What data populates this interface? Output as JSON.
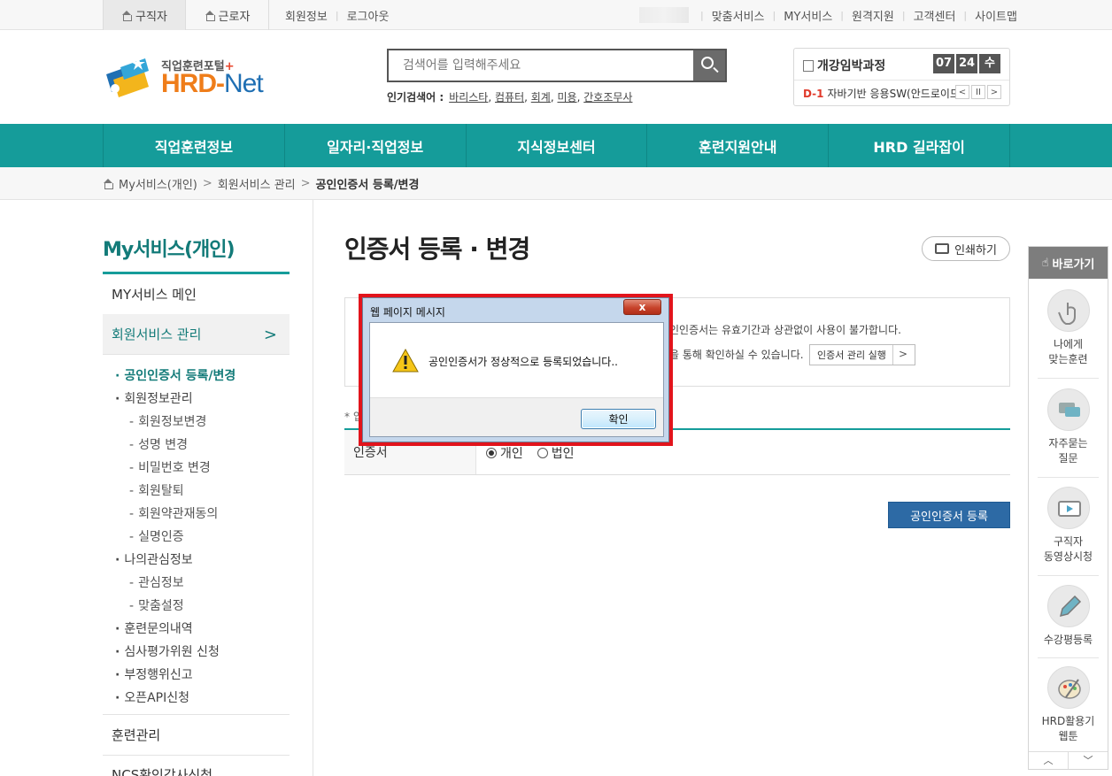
{
  "topbar": {
    "tab_job_seeker": "구직자",
    "tab_worker": "근로자",
    "member_info": "회원정보",
    "logout": "로그아웃",
    "links": [
      "맞춤서비스",
      "MY서비스",
      "원격지원",
      "고객센터",
      "사이트맵"
    ]
  },
  "header": {
    "logo_sub": "직업훈련포털",
    "logo_plus": "+",
    "logo_main_a": "HRD",
    "logo_main_dash": "-",
    "logo_main_b": "Net",
    "search_placeholder": "검색어를 입력해주세요",
    "popular_label": "인기검색어 :",
    "popular_terms": [
      "바리스타",
      "컴퓨터",
      "회계",
      "미용",
      "간호조무사"
    ],
    "opening_title": "개강임박과정",
    "date_month": "07",
    "date_day": "24",
    "date_weekday": "수",
    "dday": "D-1",
    "course_name": "자바기반 응용SW(안드로이드",
    "ctrl_prev": "<",
    "ctrl_pause": "II",
    "ctrl_next": ">"
  },
  "gnb": [
    "직업훈련정보",
    "일자리·직업정보",
    "지식정보센터",
    "훈련지원안내",
    "HRD 길라잡이"
  ],
  "breadcrumb": {
    "items": [
      "My서비스(개인)",
      "회원서비스 관리",
      "공인인증서 등록/변경"
    ]
  },
  "lnb": {
    "title": "My서비스(개인)",
    "main_1": "MY서비스 메인",
    "main_2": "회원서비스 관리",
    "main_2_chev": ">",
    "sub": [
      "공인인증서 등록/변경",
      "회원정보관리",
      "회원정보변경",
      "성명 변경",
      "비밀번호 변경",
      "회원탈퇴",
      "회원약관재동의",
      "실명인증",
      "나의관심정보",
      "관심정보",
      "맞춤설정",
      "훈련문의내역",
      "심사평가위원 신청",
      "부정행위신고",
      "오픈API신청"
    ],
    "main_3": "훈련관리",
    "main_4": "NCS확인강사신청"
  },
  "content": {
    "title": "인증서 등록 · 변경",
    "print_label": "인쇄하기",
    "info_line1": "인인증서는 유효기간과 상관없이 사용이 불가합니다.",
    "info_line2": "을 통해 확인하실 수 있습니다.",
    "manager_btn": "인증서 관리 실행",
    "manager_gt": ">",
    "required_note": "* 입",
    "field_label": "인증서",
    "radio_personal": "개인",
    "radio_corporate": "법인",
    "register_btn": "공인인증서 등록"
  },
  "quick": {
    "title": "바로가기",
    "items": [
      {
        "line1": "나에게",
        "line2": "맞는훈련"
      },
      {
        "line1": "자주묻는",
        "line2": "질문"
      },
      {
        "line1": "구직자",
        "line2": "동영상시청"
      },
      {
        "line1": "수강평등록",
        "line2": ""
      },
      {
        "line1": "HRD활용기",
        "line2": "웹툰"
      }
    ],
    "up": "︿",
    "down": "﹀"
  },
  "dialog": {
    "title": "웹 페이지 메시지",
    "close": "x",
    "message": "공인인증서가 정상적으로 등록되었습니다..",
    "ok": "확인"
  },
  "colors": {
    "gnb": "#159c9a",
    "accent_text": "#137b79",
    "register_button": "#2d6aa5",
    "dialog_highlight": "#e2141c",
    "dday": "#e0392a"
  }
}
